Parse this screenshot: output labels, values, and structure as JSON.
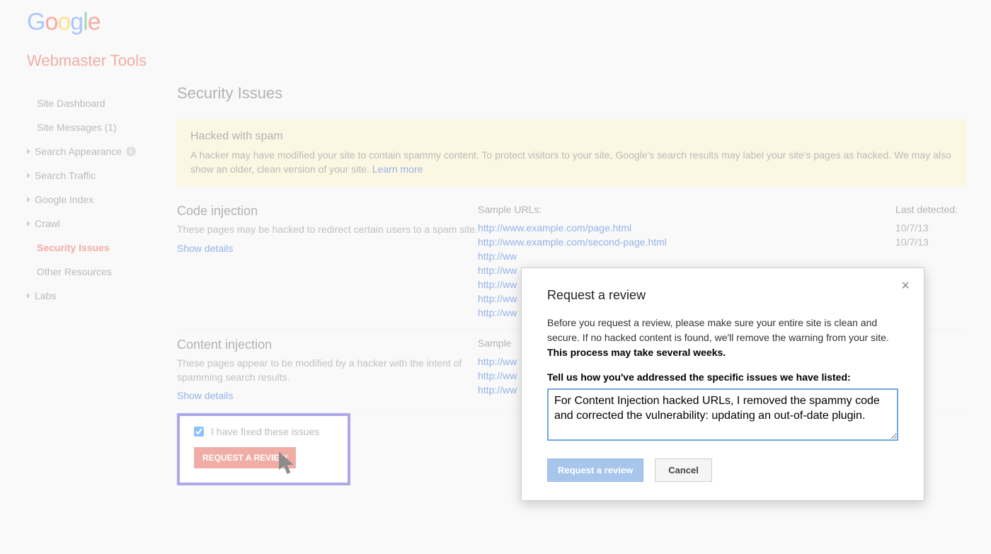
{
  "header": {
    "logo_chars": [
      "G",
      "o",
      "o",
      "g",
      "l",
      "e"
    ],
    "product_title": "Webmaster Tools"
  },
  "sidebar": {
    "items": [
      {
        "label": "Site Dashboard",
        "caret": false,
        "active": false,
        "indent": true
      },
      {
        "label": "Site Messages (1)",
        "caret": false,
        "active": false,
        "indent": true
      },
      {
        "label": "Search Appearance",
        "caret": true,
        "active": false,
        "info": true
      },
      {
        "label": "Search Traffic",
        "caret": true,
        "active": false
      },
      {
        "label": "Google Index",
        "caret": true,
        "active": false
      },
      {
        "label": "Crawl",
        "caret": true,
        "active": false
      },
      {
        "label": "Security Issues",
        "caret": false,
        "active": true,
        "indent": true
      },
      {
        "label": "Other Resources",
        "caret": false,
        "active": false,
        "indent": true
      },
      {
        "label": "Labs",
        "caret": true,
        "active": false
      }
    ]
  },
  "main": {
    "title": "Security Issues",
    "alert": {
      "title": "Hacked with spam",
      "text": "A hacker may have modified your site to contain spammy content. To protect visitors to your site, Google's search results may label your site's pages as hacked. We may also show an older, clean version of your site. ",
      "link": "Learn more"
    },
    "col_headers": {
      "urls": "Sample URLs:",
      "date": "Last detected:"
    },
    "sections": [
      {
        "title": "Code injection",
        "desc": "These pages may be hacked to redirect certain users to a spam site.",
        "details": "Show details",
        "urls": [
          "http://www.example.com/page.html",
          "http://www.example.com/second-page.html",
          "http://ww",
          "http://ww",
          "http://ww",
          "http://ww",
          "http://ww"
        ],
        "dates": [
          "10/7/13",
          "10/7/13"
        ]
      },
      {
        "title": "Content injection",
        "desc": "These pages appear to be modified by a hacker with the intent of spamming search results.",
        "details": "Show details",
        "col_header": "Sample",
        "urls": [
          "http://ww",
          "http://ww",
          "http://ww"
        ]
      }
    ],
    "fix_box": {
      "checkbox_label": "I have fixed these issues",
      "button": "REQUEST A REVIEW"
    }
  },
  "modal": {
    "title": "Request a review",
    "text_before": "Before you request a review, please make sure your entire site is clean and secure. If no hacked content is found, we'll remove the warning from your site. ",
    "text_bold": "This process may take several weeks.",
    "label": "Tell us how you've addressed the specific issues we have listed:",
    "textarea_value": "For Content Injection hacked URLs, I removed the spammy code and corrected the vulnerability: updating an out-of-date plugin.",
    "primary": "Request a review",
    "secondary": "Cancel"
  }
}
